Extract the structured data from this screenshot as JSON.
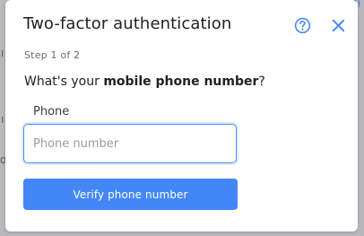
{
  "dialog": {
    "title": "Two-factor authentication",
    "step_text": "Step 1 of 2",
    "question_prefix": "What's your ",
    "question_bold": "mobile phone number",
    "question_suffix": "?",
    "phone_label": "Phone",
    "phone_placeholder": "Phone number",
    "phone_value": "",
    "verify_label": "Verify phone number",
    "help_icon": "help-circle-icon",
    "close_icon": "close-icon"
  },
  "backdrop": {
    "fragments": [
      "ı",
      "ı",
      "o",
      "(?)"
    ]
  },
  "colors": {
    "accent": "#4386f5",
    "focus_border": "#4d8ff5",
    "title_text": "#202124",
    "muted_text": "#6b6b70",
    "backdrop": "#b9b9bb"
  }
}
